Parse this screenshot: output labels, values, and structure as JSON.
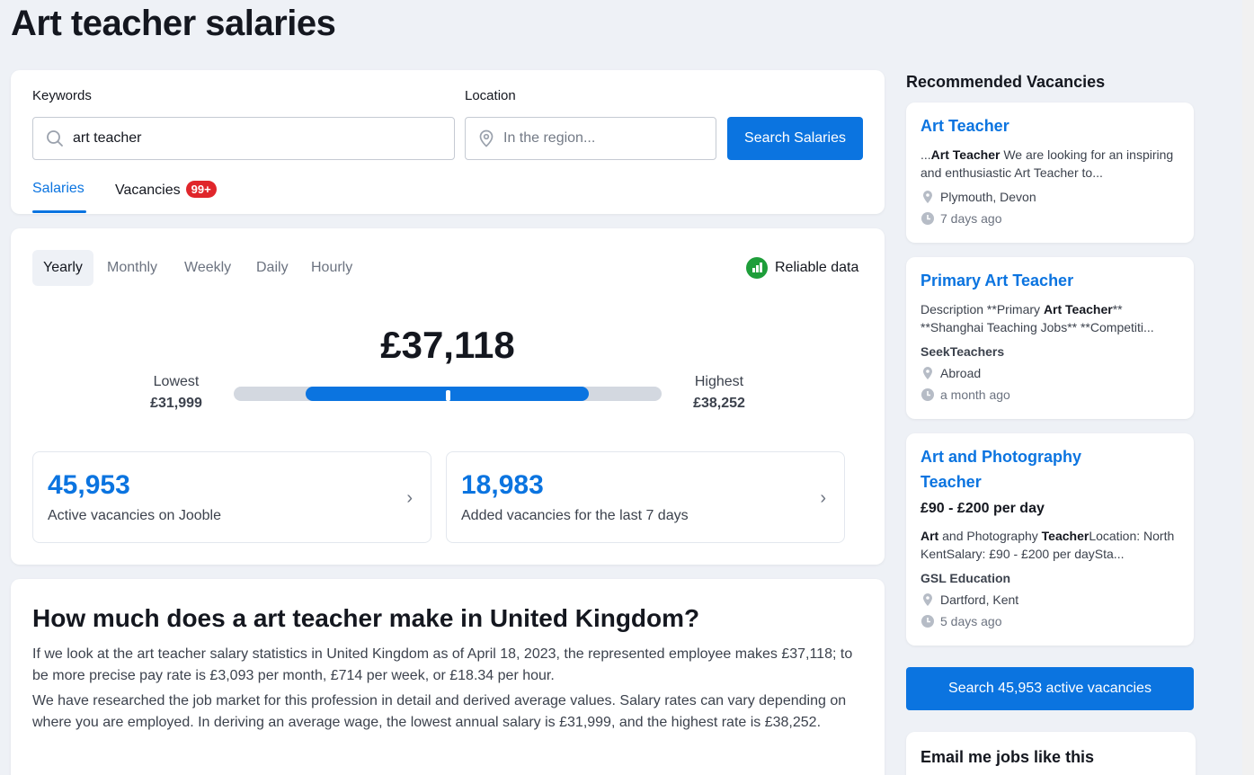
{
  "page": {
    "title": "Art teacher salaries"
  },
  "search": {
    "keywords_label": "Keywords",
    "keywords_value": "art teacher",
    "location_label": "Location",
    "location_placeholder": "In the region...",
    "button_label": "Search Salaries",
    "tabs": [
      {
        "label": "Salaries",
        "active": true
      },
      {
        "label": "Vacancies",
        "badge": "99+"
      }
    ]
  },
  "salary": {
    "periods": [
      "Yearly",
      "Monthly",
      "Weekly",
      "Daily",
      "Hourly"
    ],
    "active_period": "Yearly",
    "reliable_label": "Reliable data",
    "average": "£37,118",
    "lowest_label": "Lowest",
    "lowest_value": "£31,999",
    "highest_label": "Highest",
    "highest_value": "£38,252",
    "stats": [
      {
        "number": "45,953",
        "text": "Active vacancies on Jooble"
      },
      {
        "number": "18,983",
        "text": "Added vacancies for the last 7 days"
      }
    ]
  },
  "article": {
    "title": "How much does a art teacher make in United Kingdom?",
    "paragraphs": [
      "If we look at the art teacher salary statistics in United Kingdom as of April 18, 2023, the represented employee makes £37,118; to be more precise pay rate is £3,093 per month, £714 per week, or £18.34 per hour.",
      "We have researched the job market for this profession in detail and derived average values. Salary rates can vary depending on where you are employed. In deriving an average wage, the lowest annual salary is £31,999, and the highest rate is £38,252."
    ]
  },
  "sidebar": {
    "title": "Recommended Vacancies",
    "vacancies": [
      {
        "title": "Art Teacher",
        "snippet_pre": " ...",
        "snippet_bold": "Art Teacher",
        "snippet_post": " We are looking for an inspiring and enthusiastic Art Teacher to...",
        "location": "Plymouth, Devon",
        "posted": "7 days ago"
      },
      {
        "title": "Primary Art Teacher",
        "snippet_pre": "Description **Primary ",
        "snippet_bold": "Art Teacher",
        "snippet_post": "** **Shanghai Teaching Jobs** **Competiti...",
        "company": "SeekTeachers",
        "location": "Abroad",
        "posted": "a month ago"
      },
      {
        "title": "Art and Photography Teacher",
        "salary": "£90 - £200 per day",
        "snippet_bold1": "Art",
        "snippet_mid": " and Photography ",
        "snippet_bold2": "Teacher",
        "snippet_post": "Location: North KentSalary: £90 - £200 per daySta...",
        "company": "GSL Education",
        "location": "Dartford, Kent",
        "posted": "5 days ago"
      }
    ],
    "cta_label": "Search 45,953 active vacancies",
    "email_title": "Email me jobs like this"
  },
  "colors": {
    "accent": "#0b74e0",
    "badge": "#e0262b",
    "reliable": "#1e9e3a"
  },
  "icons": [
    "search-icon",
    "location-pin-icon",
    "bar-chart-icon",
    "chevron-right-icon",
    "clock-icon"
  ]
}
